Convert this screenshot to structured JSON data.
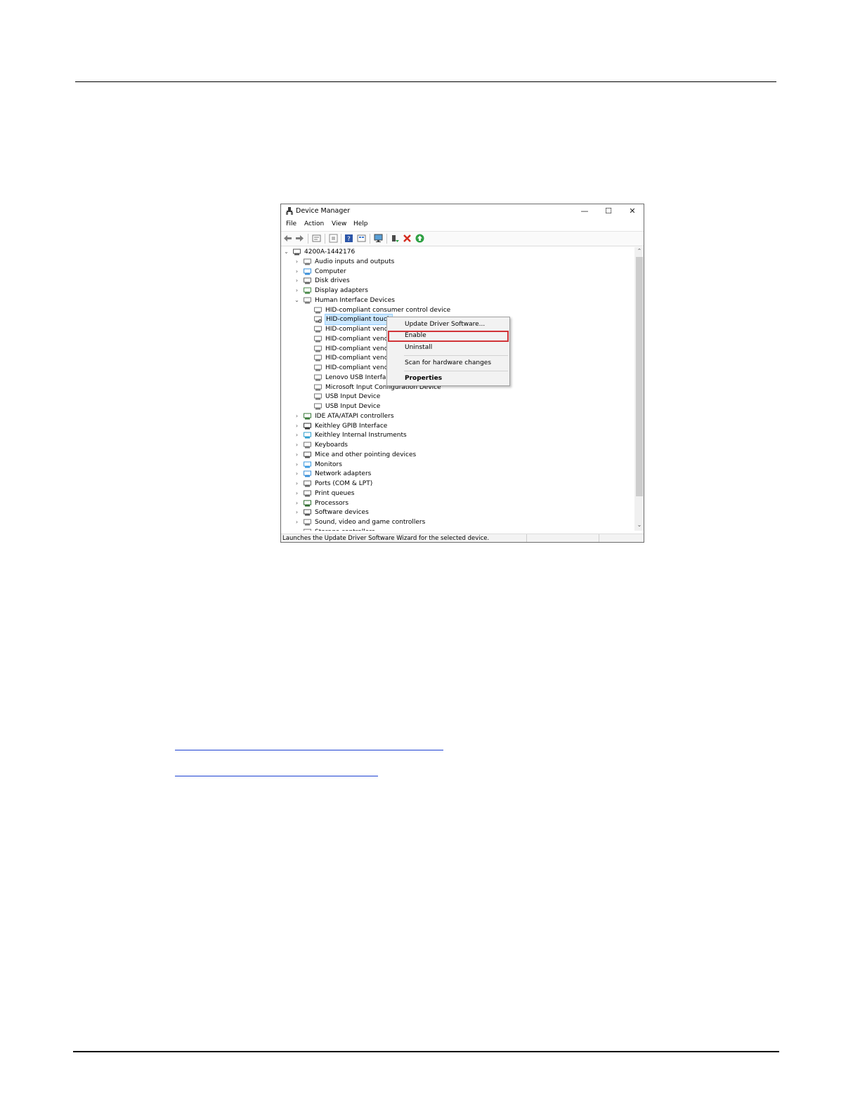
{
  "window": {
    "title": "Device Manager",
    "controls": {
      "minimize": "—",
      "maximize": "☐",
      "close": "✕"
    }
  },
  "menu": [
    "File",
    "Action",
    "View",
    "Help"
  ],
  "toolbar_icons": [
    "back-arrow-icon",
    "forward-arrow-icon",
    "properties-pane-icon",
    "refresh-icon",
    "help-icon",
    "view-icon",
    "monitor-icon",
    "update-driver-icon",
    "uninstall-x-icon",
    "enable-arrow-icon"
  ],
  "tree": [
    {
      "label": "4200A-1442176",
      "level": 0,
      "expanded": true,
      "icon": "computer-root-icon"
    },
    {
      "label": "Audio inputs and outputs",
      "level": 1,
      "icon": "speaker-icon"
    },
    {
      "label": "Computer",
      "level": 1,
      "icon": "computer-icon"
    },
    {
      "label": "Disk drives",
      "level": 1,
      "icon": "disk-icon"
    },
    {
      "label": "Display adapters",
      "level": 1,
      "icon": "display-adapter-icon"
    },
    {
      "label": "Human Interface Devices",
      "level": 1,
      "expanded": true,
      "icon": "hid-icon"
    },
    {
      "label": "HID-compliant consumer control device",
      "level": 2,
      "icon": "hid-icon"
    },
    {
      "label": "HID-compliant touch",
      "level": 2,
      "icon": "hid-disabled-icon",
      "selected": true
    },
    {
      "label": "HID-compliant vendo",
      "level": 2,
      "icon": "hid-icon"
    },
    {
      "label": "HID-compliant vendo",
      "level": 2,
      "icon": "hid-icon"
    },
    {
      "label": "HID-compliant vendo",
      "level": 2,
      "icon": "hid-icon"
    },
    {
      "label": "HID-compliant vendo",
      "level": 2,
      "icon": "hid-icon"
    },
    {
      "label": "HID-compliant vendo",
      "level": 2,
      "icon": "hid-icon"
    },
    {
      "label": "Lenovo USB Interface",
      "level": 2,
      "icon": "hid-icon"
    },
    {
      "label": "Microsoft Input Configuration Device",
      "level": 2,
      "icon": "hid-icon"
    },
    {
      "label": "USB Input Device",
      "level": 2,
      "icon": "hid-icon"
    },
    {
      "label": "USB Input Device",
      "level": 2,
      "icon": "hid-icon"
    },
    {
      "label": "IDE ATA/ATAPI controllers",
      "level": 1,
      "icon": "ide-icon"
    },
    {
      "label": "Keithley GPIB Interface",
      "level": 1,
      "icon": "gpib-icon"
    },
    {
      "label": "Keithley Internal Instruments",
      "level": 1,
      "icon": "instrument-icon"
    },
    {
      "label": "Keyboards",
      "level": 1,
      "icon": "keyboard-icon"
    },
    {
      "label": "Mice and other pointing devices",
      "level": 1,
      "icon": "mouse-icon"
    },
    {
      "label": "Monitors",
      "level": 1,
      "icon": "monitor-icon"
    },
    {
      "label": "Network adapters",
      "level": 1,
      "icon": "network-icon"
    },
    {
      "label": "Ports (COM & LPT)",
      "level": 1,
      "icon": "port-icon"
    },
    {
      "label": "Print queues",
      "level": 1,
      "icon": "printer-icon"
    },
    {
      "label": "Processors",
      "level": 1,
      "icon": "processor-icon"
    },
    {
      "label": "Software devices",
      "level": 1,
      "icon": "software-device-icon"
    },
    {
      "label": "Sound, video and game controllers",
      "level": 1,
      "icon": "sound-icon"
    },
    {
      "label": "Storage controllers",
      "level": 1,
      "icon": "storage-icon"
    }
  ],
  "context_menu": {
    "update": "Update Driver Software...",
    "enable": "Enable",
    "uninstall": "Uninstall",
    "scan": "Scan for hardware changes",
    "properties": "Properties",
    "highlight_color": "#d13438"
  },
  "status_text": "Launches the Update Driver Software Wizard for the selected device.",
  "colors": {
    "selection": "#cce8ff",
    "link": "#1a3fd1"
  }
}
